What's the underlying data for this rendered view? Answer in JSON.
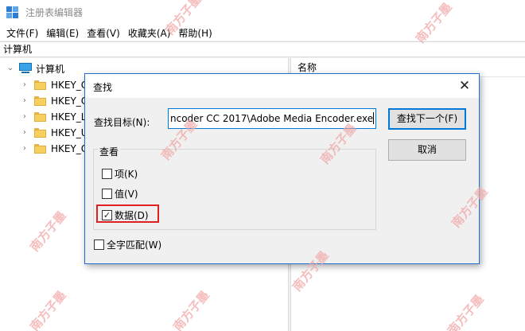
{
  "window": {
    "title": "注册表编辑器",
    "icon": "regedit-icon"
  },
  "menu": [
    "文件(F)",
    "编辑(E)",
    "查看(V)",
    "收藏夹(A)",
    "帮助(H)"
  ],
  "address": "计算机",
  "tree": {
    "root": "计算机",
    "children": [
      "HKEY_CL",
      "HKEY_CU",
      "HKEY_LO",
      "HKEY_US",
      "HKEY_CU"
    ]
  },
  "list": {
    "name_header": "名称"
  },
  "dialog": {
    "title": "查找",
    "find_label": "查找目标(N):",
    "find_value": "ncoder CC 2017\\Adobe Media Encoder.exe",
    "find_next": "查找下一个(F)",
    "cancel": "取消",
    "group_title": "查看",
    "options": [
      {
        "label": "项(K)",
        "checked": false
      },
      {
        "label": "值(V)",
        "checked": false
      },
      {
        "label": "数据(D)",
        "checked": true
      }
    ],
    "whole_word": {
      "label": "全字匹配(W)",
      "checked": false
    }
  },
  "watermark": "南方子墨",
  "colors": {
    "accent": "#0078d7",
    "highlight": "#e02020",
    "watermark": "#f2a8a8"
  }
}
